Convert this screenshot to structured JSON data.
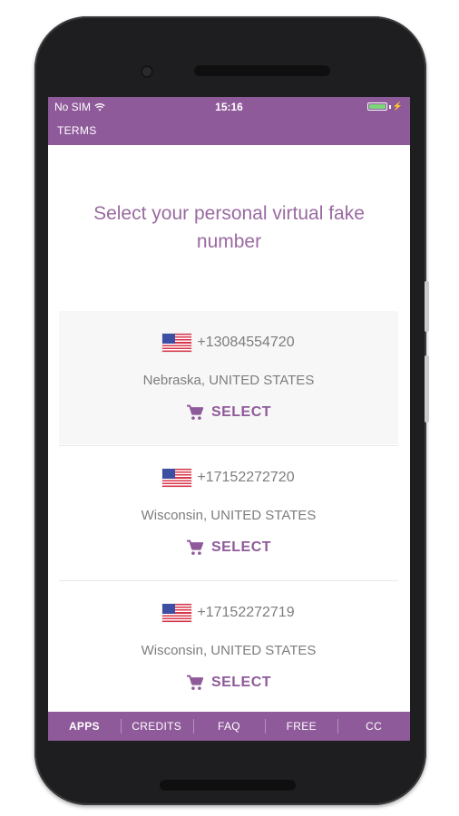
{
  "status_bar": {
    "carrier": "No SIM",
    "time": "15:16"
  },
  "app_bar": {
    "terms_label": "TERMS"
  },
  "heading": "Select your personal virtual fake number",
  "numbers": [
    {
      "number": "+13084554720",
      "location": "Nebraska, UNITED STATES",
      "select_label": "SELECT"
    },
    {
      "number": "+17152272720",
      "location": "Wisconsin, UNITED STATES",
      "select_label": "SELECT"
    },
    {
      "number": "+17152272719",
      "location": "Wisconsin, UNITED STATES",
      "select_label": "SELECT"
    }
  ],
  "bottom_nav": [
    {
      "label": "APPS",
      "active": true
    },
    {
      "label": "CREDITS",
      "active": false
    },
    {
      "label": "FAQ",
      "active": false
    },
    {
      "label": "FREE",
      "active": false
    },
    {
      "label": "CC",
      "active": false
    }
  ],
  "colors": {
    "accent": "#8f5a9a",
    "heading": "#9a6aa2",
    "text_muted": "#7d7d7d",
    "battery": "#7cd67a"
  },
  "icons": {
    "flag": "us-flag-icon",
    "cart": "shopping-cart-icon",
    "wifi": "wifi-icon",
    "battery": "battery-icon"
  }
}
